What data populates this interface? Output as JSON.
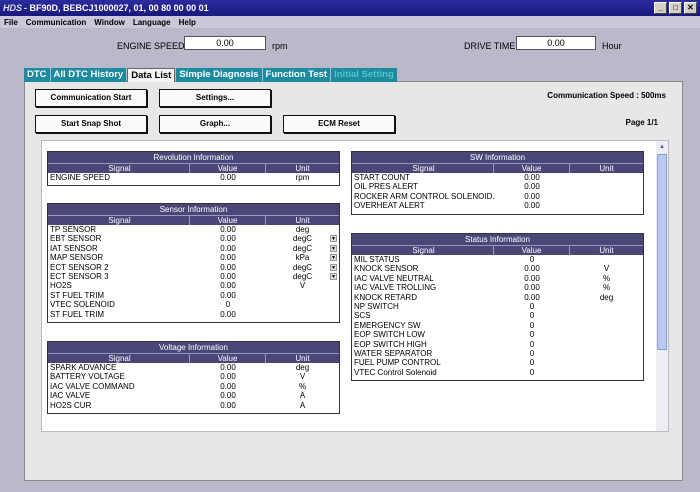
{
  "window": {
    "title": "- BF90D, BEBCJ1000027, 01,  00 80 00 00 01",
    "logo": "HDS",
    "buttons": {
      "min": "_",
      "max": "□",
      "close": "✕"
    }
  },
  "menu": [
    "File",
    "Communication",
    "Window",
    "Language",
    "Help"
  ],
  "header": {
    "engine_speed_label": "ENGINE SPEED",
    "engine_speed_value": "0.00",
    "engine_speed_unit": "rpm",
    "drive_time_label": "DRIVE TIME",
    "drive_time_value": "0.00",
    "drive_time_unit": "Hour"
  },
  "tabs": [
    {
      "label": "DTC"
    },
    {
      "label": "All DTC History"
    },
    {
      "label": "Data List"
    },
    {
      "label": "Simple Diagnosis"
    },
    {
      "label": "Function Test"
    },
    {
      "label": "Initial Setting"
    }
  ],
  "buttons": {
    "comm_start": "Communication Start",
    "settings": "Settings...",
    "snap_shot": "Start Snap Shot",
    "graph": "Graph...",
    "ecm_reset": "ECM Reset"
  },
  "info": {
    "comm_speed": "Communication Speed : 500ms",
    "page": "Page 1/1"
  },
  "columns": {
    "signal": "Signal",
    "value": "Value",
    "unit": "Unit"
  },
  "tables": {
    "revolution": {
      "title": "Revolution Information",
      "rows": [
        {
          "signal": "ENGINE SPEED",
          "value": "0.00",
          "unit": "rpm"
        }
      ]
    },
    "sensor": {
      "title": "Sensor Information",
      "rows": [
        {
          "signal": "TP SENSOR",
          "value": "0.00",
          "unit": "deg"
        },
        {
          "signal": "EBT SENSOR",
          "value": "0.00",
          "unit": "degC",
          "dropdown": true
        },
        {
          "signal": "IAT SENSOR",
          "value": "0.00",
          "unit": "degC",
          "dropdown": true
        },
        {
          "signal": "MAP SENSOR",
          "value": "0.00",
          "unit": "kPa",
          "dropdown": true
        },
        {
          "signal": "ECT SENSOR 2",
          "value": "0.00",
          "unit": "degC",
          "dropdown": true
        },
        {
          "signal": "ECT SENSOR 3",
          "value": "0.00",
          "unit": "degC",
          "dropdown": true
        },
        {
          "signal": "HO2S",
          "value": "0.00",
          "unit": "V"
        },
        {
          "signal": "ST FUEL TRIM",
          "value": "0.00",
          "unit": ""
        },
        {
          "signal": "VTEC SOLENOID",
          "value": "0",
          "unit": ""
        },
        {
          "signal": "ST FUEL TRIM",
          "value": "0.00",
          "unit": ""
        }
      ]
    },
    "voltage": {
      "title": "Voltage Information",
      "rows": [
        {
          "signal": "SPARK ADVANCE",
          "value": "0.00",
          "unit": "deg"
        },
        {
          "signal": "BATTERY VOLTAGE",
          "value": "0.00",
          "unit": "V"
        },
        {
          "signal": "IAC VALVE COMMAND",
          "value": "0.00",
          "unit": "%"
        },
        {
          "signal": "IAC VALVE",
          "value": "0.00",
          "unit": "A"
        },
        {
          "signal": "HO2S CUR",
          "value": "0.00",
          "unit": "A"
        }
      ]
    },
    "sw": {
      "title": "SW Information",
      "rows": [
        {
          "signal": "START COUNT",
          "value": "0.00",
          "unit": ""
        },
        {
          "signal": "OIL PRES ALERT",
          "value": "0.00",
          "unit": ""
        },
        {
          "signal": "ROCKER ARM CONTROL SOLENOID...",
          "value": "0.00",
          "unit": ""
        },
        {
          "signal": "OVERHEAT ALERT",
          "value": "0.00",
          "unit": ""
        }
      ]
    },
    "status": {
      "title": "Status Information",
      "rows": [
        {
          "signal": "MIL STATUS",
          "value": "0",
          "unit": ""
        },
        {
          "signal": "KNOCK SENSOR",
          "value": "0.00",
          "unit": "V"
        },
        {
          "signal": "IAC VALVE NEUTRAL",
          "value": "0.00",
          "unit": "%"
        },
        {
          "signal": "IAC VALVE TROLLING",
          "value": "0.00",
          "unit": "%"
        },
        {
          "signal": "KNOCK RETARD",
          "value": "0.00",
          "unit": "deg"
        },
        {
          "signal": "NP SWITCH",
          "value": "0",
          "unit": ""
        },
        {
          "signal": "SCS",
          "value": "0",
          "unit": ""
        },
        {
          "signal": "EMERGENCY SW",
          "value": "0",
          "unit": ""
        },
        {
          "signal": "EOP SWITCH LOW",
          "value": "0",
          "unit": ""
        },
        {
          "signal": "EOP SWITCH HIGH",
          "value": "0",
          "unit": ""
        },
        {
          "signal": "WATER SEPARATOR",
          "value": "0",
          "unit": ""
        },
        {
          "signal": "FUEL PUMP CONTROL",
          "value": "0",
          "unit": ""
        },
        {
          "signal": "VTEC Control Solenoid",
          "value": "0",
          "unit": ""
        }
      ]
    }
  },
  "icons": {
    "dropdown": "chevron-down-icon",
    "scroll_up": "arrow-up-icon"
  }
}
